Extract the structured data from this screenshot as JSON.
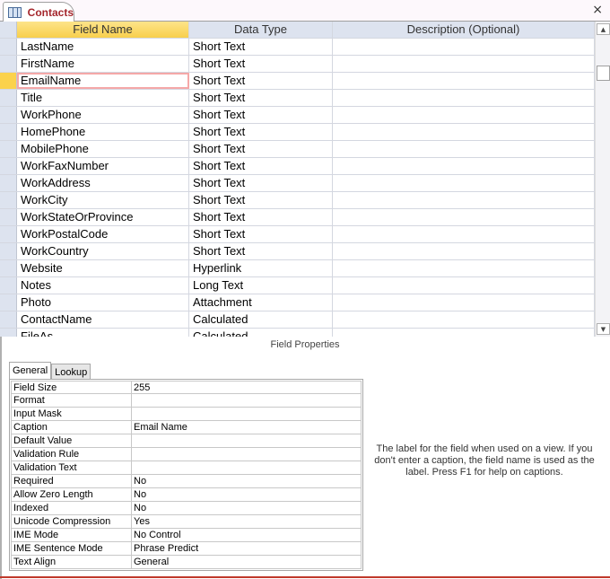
{
  "tab": {
    "title": "Contacts",
    "icon": "table-icon",
    "close": "×"
  },
  "columns": [
    "Field Name",
    "Data Type",
    "Description (Optional)"
  ],
  "fields": [
    {
      "name": "LastName",
      "type": "Short Text"
    },
    {
      "name": "FirstName",
      "type": "Short Text"
    },
    {
      "name": "EmailName",
      "type": "Short Text"
    },
    {
      "name": "Title",
      "type": "Short Text"
    },
    {
      "name": "WorkPhone",
      "type": "Short Text"
    },
    {
      "name": "HomePhone",
      "type": "Short Text"
    },
    {
      "name": "MobilePhone",
      "type": "Short Text"
    },
    {
      "name": "WorkFaxNumber",
      "type": "Short Text"
    },
    {
      "name": "WorkAddress",
      "type": "Short Text"
    },
    {
      "name": "WorkCity",
      "type": "Short Text"
    },
    {
      "name": "WorkStateOrProvince",
      "type": "Short Text"
    },
    {
      "name": "WorkPostalCode",
      "type": "Short Text"
    },
    {
      "name": "WorkCountry",
      "type": "Short Text"
    },
    {
      "name": "Website",
      "type": "Hyperlink"
    },
    {
      "name": "Notes",
      "type": "Long Text"
    },
    {
      "name": "Photo",
      "type": "Attachment"
    },
    {
      "name": "ContactName",
      "type": "Calculated"
    },
    {
      "name": "FileAs",
      "type": "Calculated"
    }
  ],
  "active_field": "EmailName",
  "field_properties": {
    "title": "Field Properties",
    "tabs": [
      "General",
      "Lookup"
    ],
    "active_tab": "General",
    "rows": [
      {
        "k": "Field Size",
        "v": "255"
      },
      {
        "k": "Format",
        "v": ""
      },
      {
        "k": "Input Mask",
        "v": ""
      },
      {
        "k": "Caption",
        "v": "Email Name"
      },
      {
        "k": "Default Value",
        "v": ""
      },
      {
        "k": "Validation Rule",
        "v": ""
      },
      {
        "k": "Validation Text",
        "v": ""
      },
      {
        "k": "Required",
        "v": "No"
      },
      {
        "k": "Allow Zero Length",
        "v": "No"
      },
      {
        "k": "Indexed",
        "v": "No"
      },
      {
        "k": "Unicode Compression",
        "v": "Yes"
      },
      {
        "k": "IME Mode",
        "v": "No Control"
      },
      {
        "k": "IME Sentence Mode",
        "v": "Phrase Predict"
      },
      {
        "k": "Text Align",
        "v": "General"
      }
    ],
    "help": "The label for the field when used on a view. If you don't enter a caption, the field name is used as the label. Press F1 for help on captions."
  }
}
